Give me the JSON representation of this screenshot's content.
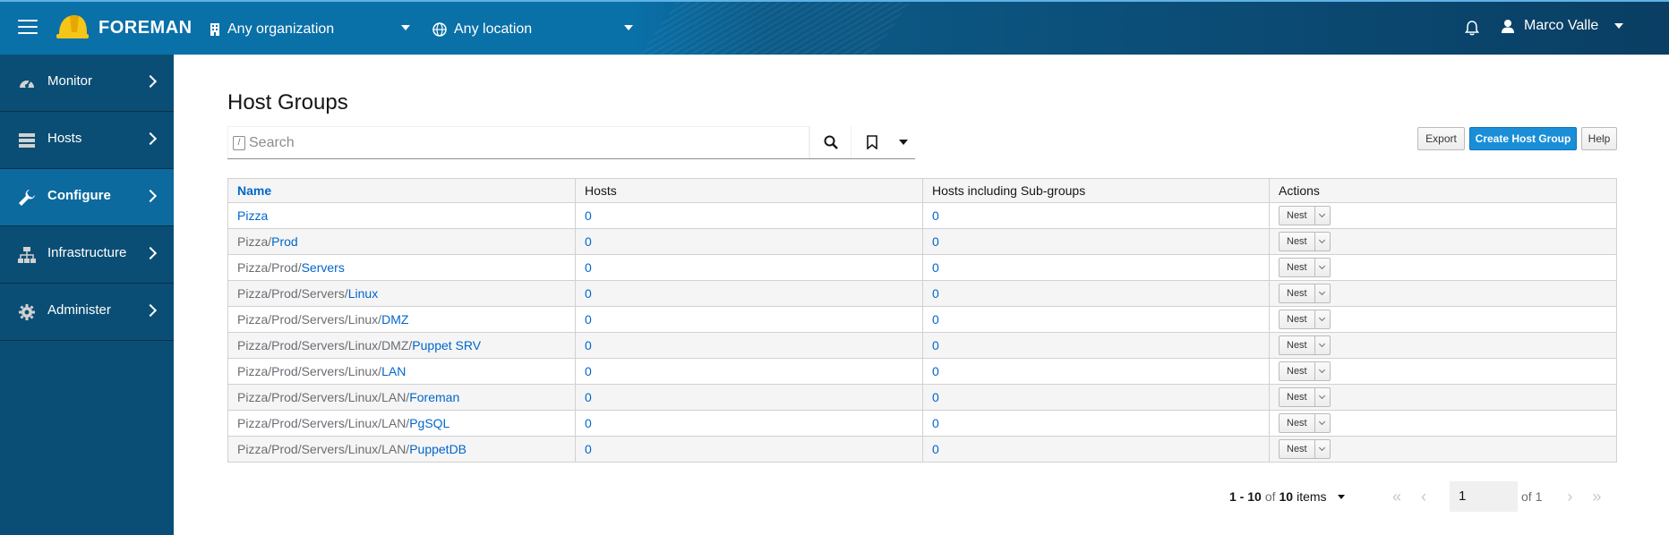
{
  "header": {
    "brand": "FOREMAN",
    "organization": "Any organization",
    "location": "Any location",
    "user": "Marco Valle"
  },
  "sidebar": {
    "items": [
      {
        "label": "Monitor",
        "icon": "dashboard-icon",
        "active": false
      },
      {
        "label": "Hosts",
        "icon": "server-icon",
        "active": false
      },
      {
        "label": "Configure",
        "icon": "wrench-icon",
        "active": true
      },
      {
        "label": "Infrastructure",
        "icon": "network-icon",
        "active": false
      },
      {
        "label": "Administer",
        "icon": "gear-icon",
        "active": false
      }
    ]
  },
  "main": {
    "title": "Host Groups",
    "search": {
      "placeholder": "Search",
      "value": ""
    },
    "buttons": {
      "export": "Export",
      "create": "Create Host Group",
      "help": "Help"
    },
    "table": {
      "columns": [
        "Name",
        "Hosts",
        "Hosts including Sub-groups",
        "Actions"
      ],
      "rows": [
        {
          "prefix": "",
          "name": "Pizza",
          "hosts": "0",
          "sub": "0",
          "action": "Nest"
        },
        {
          "prefix": "Pizza/",
          "name": "Prod",
          "hosts": "0",
          "sub": "0",
          "action": "Nest"
        },
        {
          "prefix": "Pizza/Prod/",
          "name": "Servers",
          "hosts": "0",
          "sub": "0",
          "action": "Nest"
        },
        {
          "prefix": "Pizza/Prod/Servers/",
          "name": "Linux",
          "hosts": "0",
          "sub": "0",
          "action": "Nest"
        },
        {
          "prefix": "Pizza/Prod/Servers/Linux/",
          "name": "DMZ",
          "hosts": "0",
          "sub": "0",
          "action": "Nest"
        },
        {
          "prefix": "Pizza/Prod/Servers/Linux/DMZ/",
          "name": "Puppet SRV",
          "hosts": "0",
          "sub": "0",
          "action": "Nest"
        },
        {
          "prefix": "Pizza/Prod/Servers/Linux/",
          "name": "LAN",
          "hosts": "0",
          "sub": "0",
          "action": "Nest"
        },
        {
          "prefix": "Pizza/Prod/Servers/Linux/LAN/",
          "name": "Foreman",
          "hosts": "0",
          "sub": "0",
          "action": "Nest"
        },
        {
          "prefix": "Pizza/Prod/Servers/Linux/LAN/",
          "name": "PgSQL",
          "hosts": "0",
          "sub": "0",
          "action": "Nest"
        },
        {
          "prefix": "Pizza/Prod/Servers/Linux/LAN/",
          "name": "PuppetDB",
          "hosts": "0",
          "sub": "0",
          "action": "Nest"
        }
      ]
    },
    "pagination": {
      "range": "1 - 10",
      "of_label": "of",
      "total": "10",
      "items_label": "items",
      "page": "1",
      "of_pages": "of 1"
    }
  },
  "colors": {
    "brand_blue": "#0a70a8",
    "sidebar": "#0b4e75",
    "sidebar_active": "#0c6a9e",
    "primary": "#1a8fd8",
    "link": "#0066cc"
  }
}
